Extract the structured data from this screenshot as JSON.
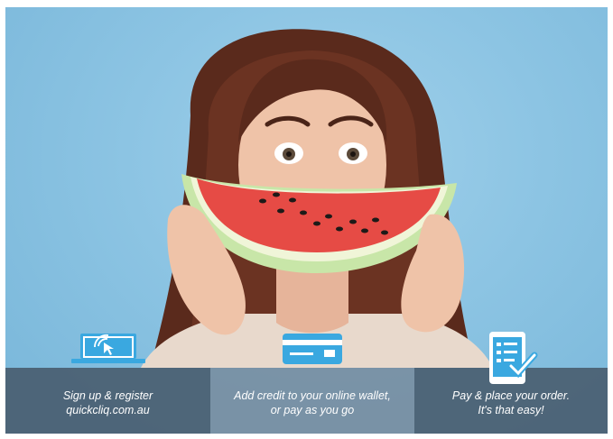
{
  "banner": {
    "steps": [
      {
        "line1": "Sign up & register",
        "line2": "quickcliq.com.au",
        "icon": "laptop-click-icon"
      },
      {
        "line1": "Add credit to your online wallet,",
        "line2": "or pay as you go",
        "icon": "credit-card-icon"
      },
      {
        "line1": "Pay & place your order.",
        "line2": "It's that easy!",
        "icon": "tablet-checklist-icon"
      }
    ]
  },
  "colors": {
    "background": "#8cc4e3",
    "step_dark": "#485c6e",
    "step_light": "#788c9e",
    "icon_blue": "#3aa8e0"
  }
}
